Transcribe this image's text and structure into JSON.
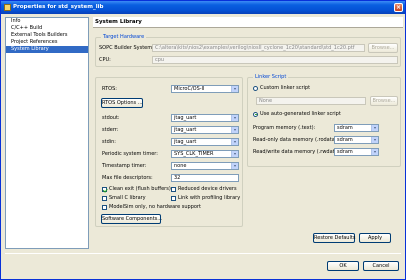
{
  "window": {
    "title": "Properties for std_system_lib"
  },
  "nav": {
    "items": [
      {
        "label": "Info",
        "selected": false
      },
      {
        "label": "C/C++ Build",
        "selected": false
      },
      {
        "label": "External Tools Builders",
        "selected": false
      },
      {
        "label": "Project References",
        "selected": false
      },
      {
        "label": "System Library",
        "selected": true
      }
    ]
  },
  "page": {
    "title": "System Library"
  },
  "target_hardware": {
    "group_label": "Target Hardware",
    "sopc_label": "SOPC Builder System:",
    "sopc_value": "C:\\altera\\kits\\nios2\\examples\\verilog\\niosII_cyclone_1c20\\standard\\std_1c20.ptf",
    "browse_label": "Browse...",
    "cpu_label": "CPU:",
    "cpu_value": "cpu"
  },
  "rtos": {
    "rtos_label": "RTOS:",
    "rtos_value": "MicroC/OS-II",
    "rtos_options_label": "RTOS Options ...",
    "stdout_label": "stdout:",
    "stdout_value": "jtag_uart",
    "stderr_label": "stderr:",
    "stderr_value": "jtag_uart",
    "stdin_label": "stdin:",
    "stdin_value": "jtag_uart",
    "periodic_timer_label": "Periodic system timer:",
    "periodic_timer_value": "SYS_CLK_TIMER",
    "timestamp_label": "Timestamp timer:",
    "timestamp_value": "none",
    "max_fd_label": "Max file descriptors:",
    "max_fd_value": "32",
    "clean_exit_label": "Clean exit (flush buffers)",
    "clean_exit_checked": true,
    "reduced_drivers_label": "Reduced device drivers",
    "reduced_drivers_checked": false,
    "small_c_label": "Small C library",
    "small_c_checked": false,
    "profiling_label": "Link with profiling library",
    "profiling_checked": false,
    "modelsim_label": "ModelSim only, no hardware support",
    "modelsim_checked": false,
    "software_components_label": "Software Components..."
  },
  "linker": {
    "group_label": "Linker Script",
    "custom_label": "Custom linker script",
    "custom_value": "None",
    "browse_label": "Browse...",
    "auto_label": "Use auto-generated linker script",
    "program_memory_label": "Program memory (.text):",
    "program_memory_value": "sdram",
    "readonly_memory_label": "Read-only data memory (.rodata):",
    "readonly_memory_value": "sdram",
    "readwrite_memory_label": "Read/write data memory (.rwdata):",
    "readwrite_memory_value": "sdram"
  },
  "footer": {
    "restore_defaults_label": "Restore Defaults",
    "apply_label": "Apply",
    "ok_label": "OK",
    "cancel_label": "Cancel"
  }
}
